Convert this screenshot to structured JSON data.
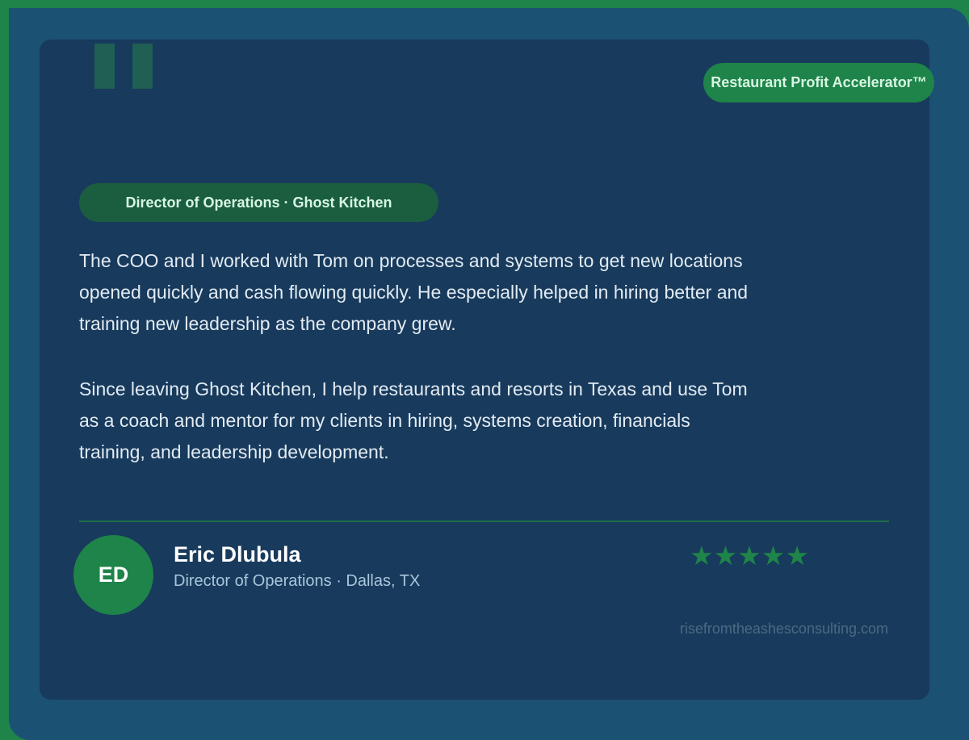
{
  "badge": {
    "program": "Restaurant Profit Accelerator™"
  },
  "role_tag": "Director of Operations · Ghost Kitchen",
  "quote": {
    "paragraphs": [
      "The COO and I worked with Tom on processes and systems to get new locations opened quickly and cash flowing quickly. He especially helped in hiring better and training new leadership as the company grew.",
      "Since leaving Ghost Kitchen, I help restaurants and resorts in Texas and use Tom as a coach and mentor for my clients in hiring, systems creation, financials training, and leadership development."
    ]
  },
  "author": {
    "initials": "ED",
    "name": "Eric Dlubula",
    "title": "Director of Operations · Dallas, TX"
  },
  "rating": {
    "stars": 5,
    "display": "★★★★★"
  },
  "website": "risefromtheashesconsulting.com",
  "colors": {
    "outer_border": "#1e8449",
    "frame": "#1b5173",
    "card": "#183a5c",
    "accent_green": "#1e8449",
    "role_tag": "#1a5e3f",
    "quote_text": "#e2ebf3",
    "meta_text": "#a9c6dc",
    "site_text": "#4b6a83"
  },
  "icons": {
    "quote": "quote-mark-icon",
    "rating": "star-icon"
  }
}
